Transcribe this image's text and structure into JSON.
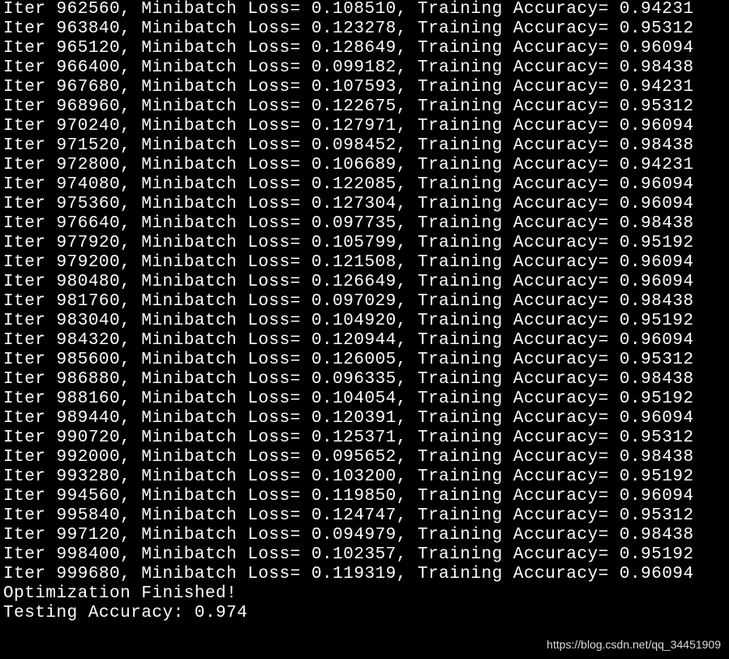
{
  "terminal": {
    "lines": [
      {
        "iter": 962560,
        "loss": "0.108510",
        "acc": "0.94231"
      },
      {
        "iter": 963840,
        "loss": "0.123278",
        "acc": "0.95312"
      },
      {
        "iter": 965120,
        "loss": "0.128649",
        "acc": "0.96094"
      },
      {
        "iter": 966400,
        "loss": "0.099182",
        "acc": "0.98438"
      },
      {
        "iter": 967680,
        "loss": "0.107593",
        "acc": "0.94231"
      },
      {
        "iter": 968960,
        "loss": "0.122675",
        "acc": "0.95312"
      },
      {
        "iter": 970240,
        "loss": "0.127971",
        "acc": "0.96094"
      },
      {
        "iter": 971520,
        "loss": "0.098452",
        "acc": "0.98438"
      },
      {
        "iter": 972800,
        "loss": "0.106689",
        "acc": "0.94231"
      },
      {
        "iter": 974080,
        "loss": "0.122085",
        "acc": "0.96094"
      },
      {
        "iter": 975360,
        "loss": "0.127304",
        "acc": "0.96094"
      },
      {
        "iter": 976640,
        "loss": "0.097735",
        "acc": "0.98438"
      },
      {
        "iter": 977920,
        "loss": "0.105799",
        "acc": "0.95192"
      },
      {
        "iter": 979200,
        "loss": "0.121508",
        "acc": "0.96094"
      },
      {
        "iter": 980480,
        "loss": "0.126649",
        "acc": "0.96094"
      },
      {
        "iter": 981760,
        "loss": "0.097029",
        "acc": "0.98438"
      },
      {
        "iter": 983040,
        "loss": "0.104920",
        "acc": "0.95192"
      },
      {
        "iter": 984320,
        "loss": "0.120944",
        "acc": "0.96094"
      },
      {
        "iter": 985600,
        "loss": "0.126005",
        "acc": "0.95312"
      },
      {
        "iter": 986880,
        "loss": "0.096335",
        "acc": "0.98438"
      },
      {
        "iter": 988160,
        "loss": "0.104054",
        "acc": "0.95192"
      },
      {
        "iter": 989440,
        "loss": "0.120391",
        "acc": "0.96094"
      },
      {
        "iter": 990720,
        "loss": "0.125371",
        "acc": "0.95312"
      },
      {
        "iter": 992000,
        "loss": "0.095652",
        "acc": "0.98438"
      },
      {
        "iter": 993280,
        "loss": "0.103200",
        "acc": "0.95192"
      },
      {
        "iter": 994560,
        "loss": "0.119850",
        "acc": "0.96094"
      },
      {
        "iter": 995840,
        "loss": "0.124747",
        "acc": "0.95312"
      },
      {
        "iter": 997120,
        "loss": "0.094979",
        "acc": "0.98438"
      },
      {
        "iter": 998400,
        "loss": "0.102357",
        "acc": "0.95192"
      },
      {
        "iter": 999680,
        "loss": "0.119319",
        "acc": "0.96094"
      }
    ],
    "finished_line": "Optimization Finished!",
    "testing_line": "Testing Accuracy: 0.974",
    "iter_prefix": "Iter ",
    "loss_prefix": ", Minibatch Loss= ",
    "acc_prefix": ", Training Accuracy= "
  },
  "watermark": "https://blog.csdn.net/qq_34451909"
}
